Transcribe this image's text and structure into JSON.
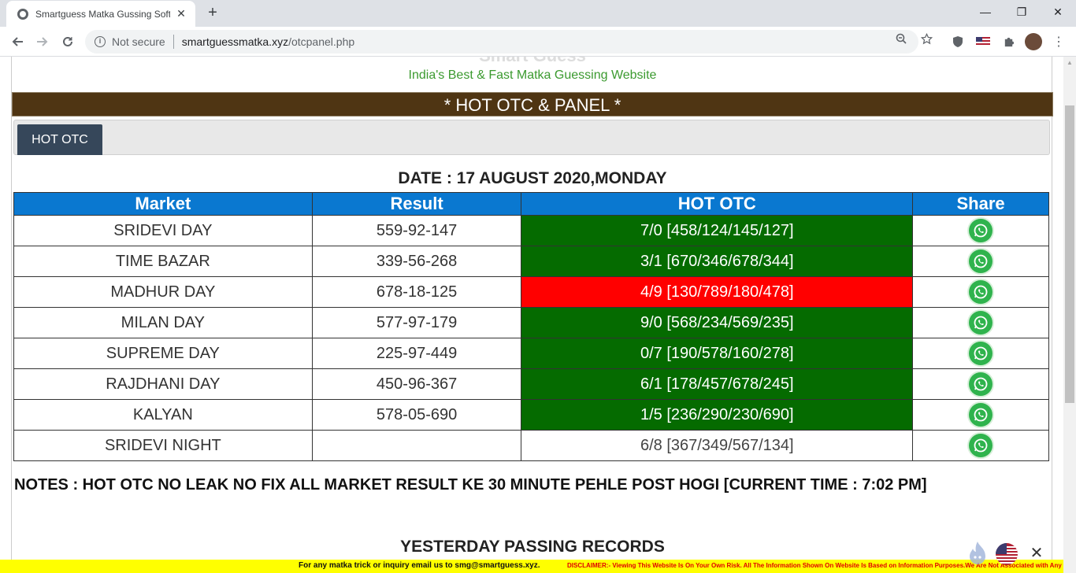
{
  "browser": {
    "tab_title": "Smartguess Matka Gussing Softw",
    "tab_close": "✕",
    "new_tab": "+",
    "security_label": "Not secure",
    "url_domain": "smartguessmatka.xyz",
    "url_path": "/otcpanel.php",
    "window_min": "—",
    "window_max": "❐",
    "window_close": "✕"
  },
  "site": {
    "logo_text": "Smart Guess",
    "tagline": "India's Best & Fast Matka Guessing Website",
    "section_header": "* HOT OTC & PANEL *",
    "tab_label": "HOT OTC",
    "date_line": "DATE : 17 AUGUST 2020,MONDAY"
  },
  "table": {
    "headers": [
      "Market",
      "Result",
      "HOT OTC",
      "Share"
    ],
    "rows": [
      {
        "market": "SRIDEVI DAY",
        "result": "559-92-147",
        "hot": "7/0 [458/124/145/127]",
        "status": "green"
      },
      {
        "market": "TIME BAZAR",
        "result": "339-56-268",
        "hot": "3/1 [670/346/678/344]",
        "status": "green"
      },
      {
        "market": "MADHUR DAY",
        "result": "678-18-125",
        "hot": "4/9 [130/789/180/478]",
        "status": "red"
      },
      {
        "market": "MILAN DAY",
        "result": "577-97-179",
        "hot": "9/0 [568/234/569/235]",
        "status": "green"
      },
      {
        "market": "SUPREME DAY",
        "result": "225-97-449",
        "hot": "0/7 [190/578/160/278]",
        "status": "green"
      },
      {
        "market": "RAJDHANI DAY",
        "result": "450-96-367",
        "hot": "6/1 [178/457/678/245]",
        "status": "green"
      },
      {
        "market": "KALYAN",
        "result": "578-05-690",
        "hot": "1/5 [236/290/230/690]",
        "status": "green"
      },
      {
        "market": "SRIDEVI NIGHT",
        "result": "",
        "hot": "6/8 [367/349/567/134]",
        "status": "plain"
      }
    ]
  },
  "notes": "NOTES : HOT OTC NO LEAK NO FIX ALL MARKET RESULT KE 30 MINUTE PEHLE POST HOGI [CURRENT TIME : 7:02 PM]",
  "yesterday_heading": "YESTERDAY PASSING RECORDS",
  "footer": {
    "contact": "For any matka trick or inquiry email us to smg@smartguess.xyz.",
    "disclaimer": "DISCLAIMER:- Viewing This Website Is On Your Own Risk. All The Information Shown On Website Is Based on Information Purposes.We Are Not Associated with Any"
  },
  "floating": {
    "close": "✕"
  },
  "colors": {
    "header_brown": "#4f3513",
    "table_header_blue": "#0a78d0",
    "pass_green": "#056b00",
    "fail_red": "#ff0000",
    "tagline_green": "#3b9a2f",
    "footer_yellow": "#ffff00"
  }
}
